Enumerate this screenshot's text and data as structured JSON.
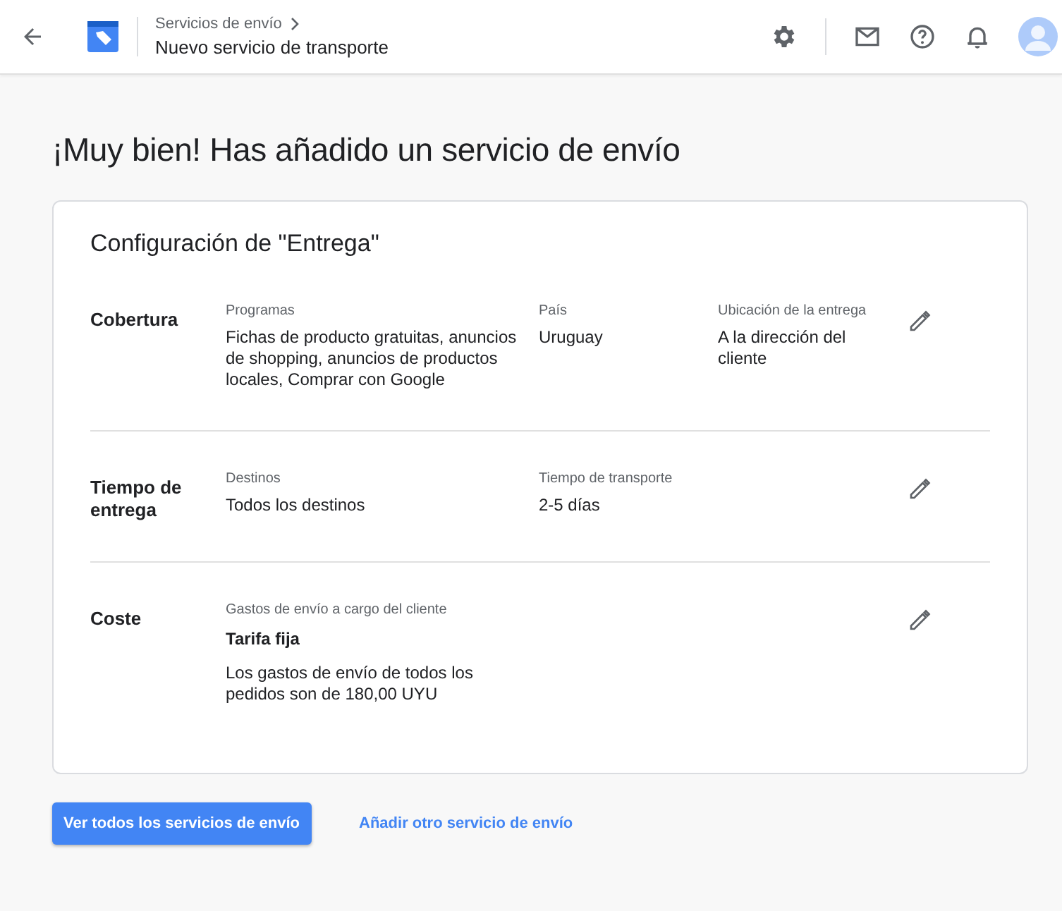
{
  "header": {
    "breadcrumb": "Servicios de envío",
    "title": "Nuevo servicio de transporte"
  },
  "heading": "¡Muy bien! Has añadido un servicio de envío",
  "card": {
    "title": "Configuración de \"Entrega\"",
    "sections": [
      {
        "label": "Cobertura",
        "fields": [
          {
            "label": "Programas",
            "value": "Fichas de producto gratuitas, anuncios de shopping, anuncios de productos locales, Comprar con Google"
          },
          {
            "label": "País",
            "value": "Uruguay"
          },
          {
            "label": "Ubicación de la entrega",
            "value": "A la dirección del cliente"
          }
        ]
      },
      {
        "label": "Tiempo de entrega",
        "fields": [
          {
            "label": "Destinos",
            "value": "Todos los destinos"
          },
          {
            "label": "Tiempo de transporte",
            "value": "2-5 días"
          }
        ]
      },
      {
        "label": "Coste",
        "fields": [
          {
            "label": "Gastos de envío a cargo del cliente",
            "subtitle": "Tarifa fija",
            "value": "Los gastos de envío de todos los pedidos son de 180,00 UYU"
          }
        ]
      }
    ]
  },
  "actions": {
    "primary": "Ver todos los servicios de envío",
    "secondary": "Añadir otro servicio de envío"
  }
}
